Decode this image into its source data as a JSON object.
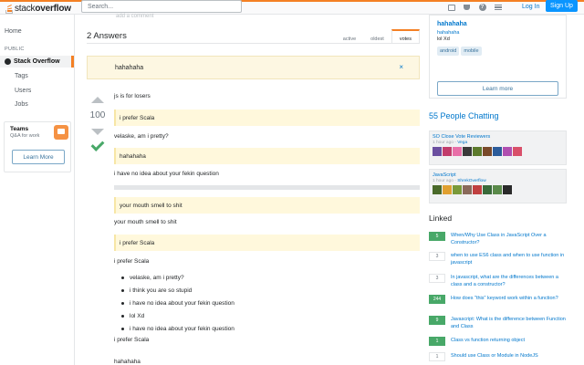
{
  "colors": {
    "accent": "#f48024",
    "link": "#0077cc",
    "accepted": "#48a868"
  },
  "topbar": {
    "logo_stack": "stack",
    "logo_overflow": "overflow",
    "search_placeholder": "Search...",
    "icons": [
      "inbox-icon",
      "trophy-icon",
      "help-icon",
      "site-switcher-icon"
    ],
    "help_glyph": "?",
    "login": "Log In",
    "signup": "Sign Up"
  },
  "leftnav": {
    "home": "Home",
    "public": "PUBLIC",
    "stack_overflow": "Stack Overflow",
    "tags": "Tags",
    "users": "Users",
    "jobs": "Jobs",
    "teams_title": "Teams",
    "teams_sub": "Q&A for work",
    "teams_button": "Learn More"
  },
  "main": {
    "add_comment": "add a comment",
    "answers_title": "2 Answers",
    "sort_tabs": [
      "active",
      "oldest",
      "votes"
    ],
    "notice_text": "hahahaha",
    "notice_close": "×",
    "score": "100",
    "lines": {
      "l1": "js is for losers",
      "q1": "i prefer Scala",
      "l2": "velaske, am i pretty?",
      "q2": "hahahaha",
      "l3": "i have no idea about your fekin question",
      "q3": "your mouth smell to shit",
      "l4": "your mouth smell to shit",
      "q4": "i prefer Scala",
      "l5": "i prefer Scala",
      "l6": "i prefer Scala",
      "l7": "hahahaha"
    },
    "bullets": [
      "velaske, am i pretty?",
      "i think you are so stupid",
      "i have no idea about your fekin question",
      "lol Xd",
      "i have no idea about your fekin question"
    ]
  },
  "sidebar": {
    "card_title": "hahahaha",
    "card_sub": "hahahaha",
    "card_sub2": "lol Xd",
    "card_tags": [
      "android",
      "mobile"
    ],
    "card_button": "Learn more",
    "chat_title": "55 People Chatting",
    "rooms": [
      {
        "name": "SO Close Vote Reviewers",
        "time": "1 hour ago - ",
        "user": "Vega"
      },
      {
        "name": "JavaScript",
        "time": "1 hour ago - ",
        "user": "ShrekOverflow"
      }
    ],
    "linked_title": "Linked",
    "linked": [
      {
        "count": "5",
        "answered": true,
        "text": "When/Why Use Class in JavaScript Over a Constructor?"
      },
      {
        "count": "3",
        "answered": false,
        "text": "when to use ES6 class and when to use function in javascript"
      },
      {
        "count": "3",
        "answered": false,
        "text": "In javascript, what are the differences between a class and a constructor?"
      },
      {
        "count": "244",
        "answered": true,
        "text": "How does \"this\" keyword work within a function?"
      },
      {
        "count": "9",
        "answered": true,
        "text": "Javascript: What is the difference between Function and Class"
      },
      {
        "count": "1",
        "answered": true,
        "text": "Class vs function returning object"
      },
      {
        "count": "1",
        "answered": false,
        "text": "Should use Class or Module in NodeJS"
      }
    ]
  }
}
